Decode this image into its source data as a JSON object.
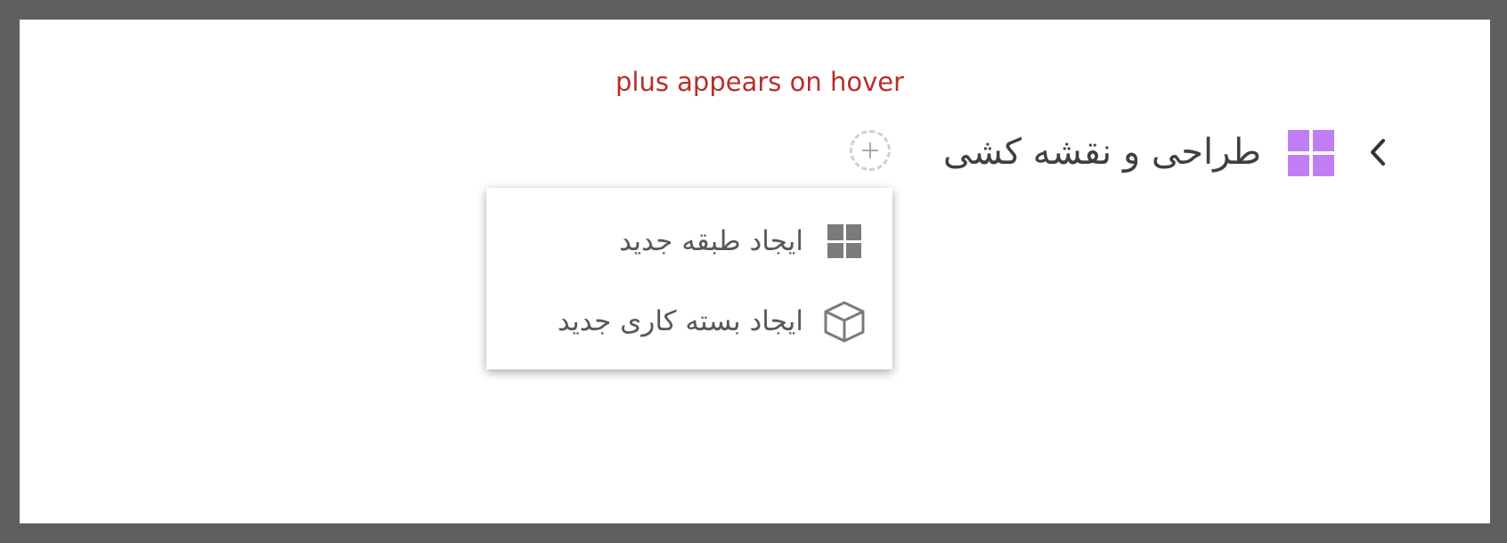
{
  "annotation": {
    "text": "plus appears on hover",
    "color": "#b5302b"
  },
  "category": {
    "title": "طراحی و نقشه کشی",
    "icon": "grid-icon",
    "icon_color": "#bf7ef4",
    "expand_icon": "chevron-left-icon"
  },
  "add_button": {
    "icon": "plus-icon"
  },
  "menu": {
    "items": [
      {
        "label": "ایجاد طبقه جدید",
        "icon": "grid-icon"
      },
      {
        "label": "ایجاد بسته کاری جدید",
        "icon": "cube-icon"
      }
    ]
  },
  "colors": {
    "frame": "#5f5f5f",
    "background": "#ffffff",
    "text": "#3f3f3f",
    "menu_text": "#575757",
    "menu_icon": "#7b7b7b"
  }
}
